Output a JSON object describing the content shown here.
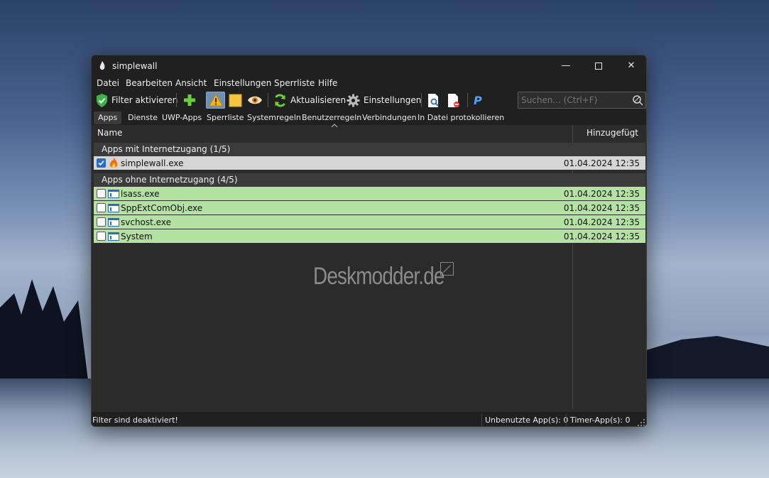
{
  "window": {
    "title": "simplewall",
    "controls": {
      "minimize": "—",
      "close": "✕"
    }
  },
  "menu": [
    "Datei",
    "Bearbeiten",
    "Ansicht",
    "Einstellungen",
    "Sperrliste",
    "Hilfe"
  ],
  "toolbar": {
    "enable_filters": "Filter aktivieren",
    "refresh": "Aktualisieren",
    "settings": "Einstellungen",
    "search_placeholder": "Suchen... (Ctrl+F)",
    "paypal_letter": "P"
  },
  "tabs": [
    "Apps",
    "Dienste",
    "UWP-Apps",
    "Sperrliste",
    "Systemregeln",
    "Benutzerregeln",
    "Verbindungen",
    "In Datei protokollieren"
  ],
  "columns": {
    "name": "Name",
    "added": "Hinzugefügt"
  },
  "groups": [
    {
      "title": "Apps mit Internetzugang (1/5)",
      "rows": [
        {
          "name": "simplewall.exe",
          "date": "01.04.2024 12:35",
          "checked": true
        }
      ]
    },
    {
      "title": "Apps ohne Internetzugang (4/5)",
      "rows": [
        {
          "name": "lsass.exe",
          "date": "01.04.2024 12:35",
          "checked": false
        },
        {
          "name": "SppExtComObj.exe",
          "date": "01.04.2024 12:35",
          "checked": false
        },
        {
          "name": "svchost.exe",
          "date": "01.04.2024 12:35",
          "checked": false
        },
        {
          "name": "System",
          "date": "01.04.2024 12:35",
          "checked": false
        }
      ]
    }
  ],
  "watermark": "Deskmodder.de",
  "status": {
    "filters": "Filter sind deaktiviert!",
    "unused": "Unbenutzte App(s): 0",
    "timer": "Timer-App(s): 0"
  },
  "colors": {
    "allowed_row": "#d6d6d6",
    "blocked_row": "#b3e2a3",
    "window_bg": "#2b2b2b",
    "checkbox_accent": "#2a6cc4"
  }
}
